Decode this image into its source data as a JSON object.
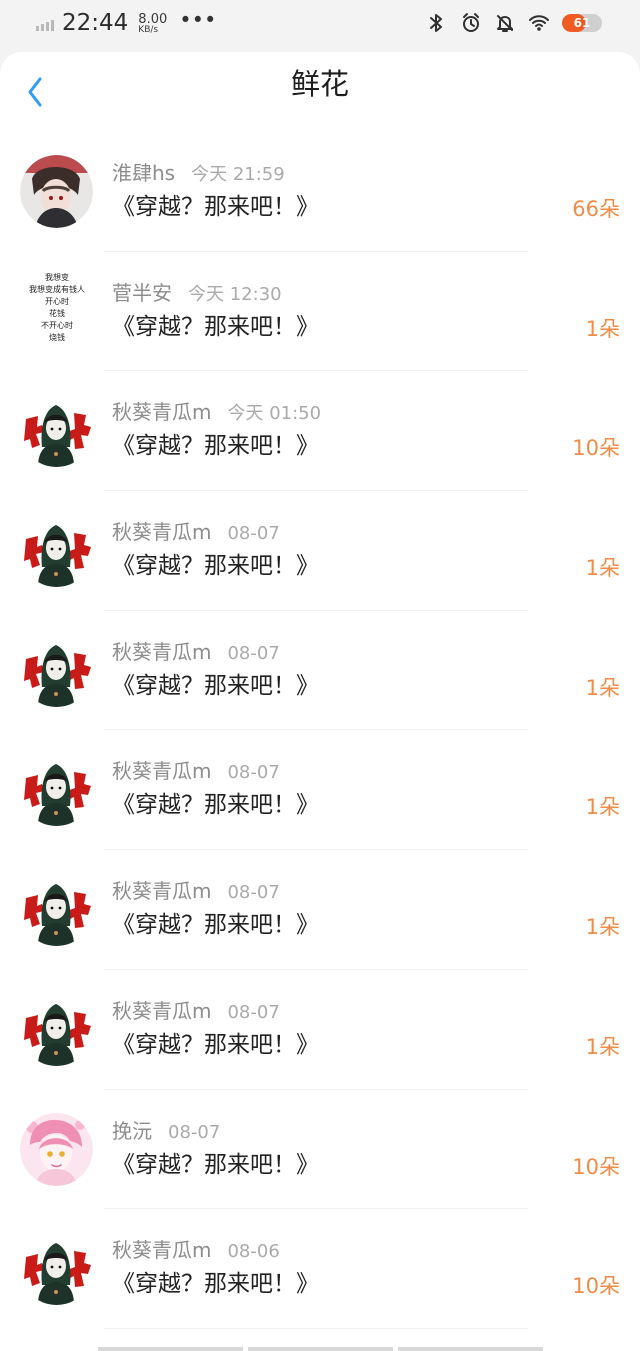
{
  "status_bar": {
    "time": "22:44",
    "speed_value": "8.00",
    "speed_unit": "KB/s",
    "more": "•••",
    "battery": "61"
  },
  "header": {
    "title": "鲜花",
    "back": "‹"
  },
  "items": [
    {
      "username": "淮肆hs",
      "time": "今天 21:59",
      "title": "《穿越？那来吧！》",
      "count": "66朵"
    },
    {
      "username": "菅半安",
      "time": "今天 12:30",
      "title": "《穿越？那来吧！》",
      "count": "1朵",
      "avatar_text": [
        "我想变",
        "我想变成有钱人",
        "开心时",
        "花钱",
        "不开心时",
        "烧钱"
      ]
    },
    {
      "username": "秋葵青瓜m",
      "time": "今天 01:50",
      "title": "《穿越？那来吧！》",
      "count": "10朵"
    },
    {
      "username": "秋葵青瓜m",
      "time": "08-07",
      "title": "《穿越？那来吧！》",
      "count": "1朵"
    },
    {
      "username": "秋葵青瓜m",
      "time": "08-07",
      "title": "《穿越？那来吧！》",
      "count": "1朵"
    },
    {
      "username": "秋葵青瓜m",
      "time": "08-07",
      "title": "《穿越？那来吧！》",
      "count": "1朵"
    },
    {
      "username": "秋葵青瓜m",
      "time": "08-07",
      "title": "《穿越？那来吧！》",
      "count": "1朵"
    },
    {
      "username": "秋葵青瓜m",
      "time": "08-07",
      "title": "《穿越？那来吧！》",
      "count": "1朵"
    },
    {
      "username": "挽沅",
      "time": "08-07",
      "title": "《穿越？那来吧！》",
      "count": "10朵"
    },
    {
      "username": "秋葵青瓜m",
      "time": "08-06",
      "title": "《穿越？那来吧！》",
      "count": "10朵"
    }
  ],
  "colors": {
    "accent": "#2d9cff",
    "count": "#f08b48",
    "battery": "#f05a23"
  }
}
